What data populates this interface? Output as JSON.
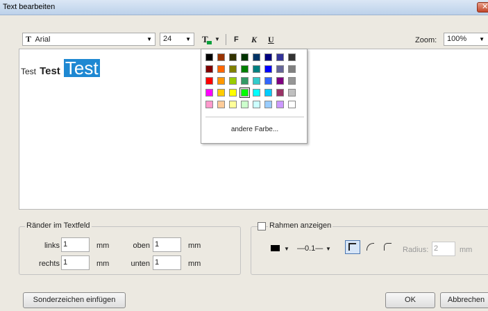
{
  "window": {
    "title": "Text bearbeiten",
    "close_symbol": "✕"
  },
  "toolbar": {
    "font_icon": "T",
    "font_name": "Arial",
    "font_size": "24",
    "dropdown_arrow": "▼",
    "color_icon": "T",
    "bold_label": "F",
    "italic_label": "K",
    "underline_label": "U",
    "zoom_label": "Zoom:",
    "zoom_value": "100%"
  },
  "editor": {
    "word1": "Test",
    "word2": "Test",
    "word3": "Test"
  },
  "palette": {
    "rows": [
      [
        "#000000",
        "#993300",
        "#333300",
        "#003300",
        "#003366",
        "#000080",
        "#333399",
        "#333333"
      ],
      [
        "#800000",
        "#ff6600",
        "#808000",
        "#008000",
        "#008080",
        "#0000ff",
        "#666699",
        "#808080"
      ],
      [
        "#ff0000",
        "#ff9900",
        "#99cc00",
        "#339966",
        "#33cccc",
        "#3366ff",
        "#800080",
        "#969696"
      ],
      [
        "#ff00ff",
        "#ffcc00",
        "#ffff00",
        "#00ff00",
        "#00ffff",
        "#00ccff",
        "#993366",
        "#c0c0c0"
      ],
      [
        "#ff99cc",
        "#ffcc99",
        "#ffff99",
        "#ccffcc",
        "#ccffff",
        "#99ccff",
        "#cc99ff",
        "#ffffff"
      ]
    ],
    "selected": "#00ff00",
    "more_label": "andere Farbe..."
  },
  "margins": {
    "title": "Ränder im Textfeld",
    "left_label": "links",
    "left_value": "1",
    "top_label": "oben",
    "top_value": "1",
    "right_label": "rechts",
    "right_value": "1",
    "bottom_label": "unten",
    "bottom_value": "1",
    "unit": "mm"
  },
  "frame": {
    "checkbox_label": "Rahmen anzeigen",
    "line_width": "—0.1—",
    "radius_label": "Radius:",
    "radius_value": "2",
    "radius_unit": "mm",
    "border_color": "#000000"
  },
  "buttons": {
    "special_chars": "Sonderzeichen einfügen",
    "ok": "OK",
    "cancel": "Abbrechen"
  }
}
